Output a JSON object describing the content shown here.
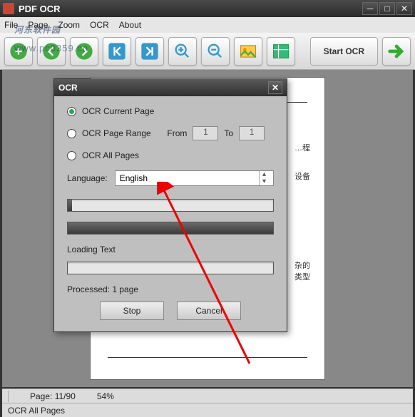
{
  "window": {
    "title": "PDF OCR"
  },
  "menubar": [
    "File",
    "Page",
    "Zoom",
    "OCR",
    "About"
  ],
  "toolbar": {
    "start_ocr": "Start OCR"
  },
  "watermark": "河东软件园",
  "watermark_url": "www.pc0359.cn",
  "statusbar": {
    "page": "Page: 11/90",
    "zoom": "54%"
  },
  "ocr_status": "OCR All Pages",
  "dialog": {
    "title": "OCR",
    "opt_current": "OCR Current Page",
    "opt_range": "OCR Page Range",
    "from": "From",
    "to": "To",
    "from_val": "1",
    "to_val": "1",
    "opt_all": "OCR All Pages",
    "lang_label": "Language:",
    "lang_value": "English",
    "progress1_pct": 2,
    "loading": "Loading Text",
    "progress2_pct": 100,
    "processed": "Processed: 1 page",
    "progress3_pct": 0,
    "stop": "Stop",
    "cancel": "Cancel",
    "selected": "current"
  },
  "page_content": {
    "t1": "…程",
    "t2": "设备",
    "t3": "杂的\n类型"
  }
}
